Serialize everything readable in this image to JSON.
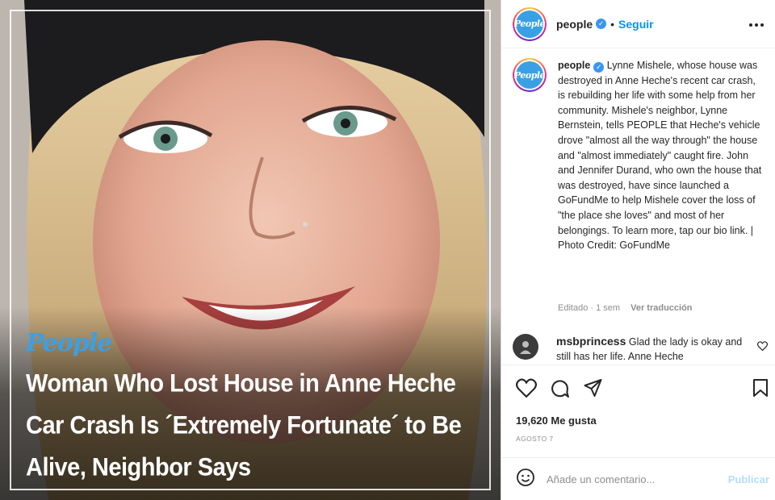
{
  "post": {
    "brand_logo": "People",
    "headline": "Woman Who Lost House in Anne Heche Car Crash Is ´Extremely Fortunate´ to Be Alive, Neighbor Says"
  },
  "header": {
    "avatar_text": "People",
    "username": "people",
    "separator": "•",
    "follow_label": "Seguir",
    "more_label": "•••"
  },
  "caption": {
    "username": "people",
    "text": "Lynne Mishele, whose house was destroyed in Anne Heche's recent car crash, is rebuilding her life with some help from her community. Mishele's neighbor, Lynne Bernstein, tells PEOPLE that Heche's vehicle drove \"almost all the way through\" the house and \"almost immediately\" caught fire. John and Jennifer Durand, who own the house that was destroyed, have since launched a GoFundMe to help Mishele cover the loss of \"the place she loves\" and most of her belongings. To learn more, tap our bio link. | Photo Credit: GoFundMe",
    "meta": "Editado · 1 sem",
    "translate_label": "Ver traducción"
  },
  "comment": {
    "username": "msbprincess",
    "text": "Glad the lady is okay and still has her life. Anne Heche"
  },
  "actions": {
    "likes": "19,620 Me gusta",
    "date": "AGOSTO 7"
  },
  "comment_box": {
    "placeholder": "Añade un comentario...",
    "publish_label": "Publicar"
  },
  "icons": {
    "like": "heart-icon",
    "comment": "comment-bubble-icon",
    "share": "paper-plane-icon",
    "save": "bookmark-icon",
    "emoji": "emoji-smile-icon",
    "verified": "verified-badge-icon",
    "more": "more-options-icon"
  },
  "colors": {
    "accent_link": "#0095f6",
    "brand_blue": "#3aa0e6",
    "publish_disabled": "#b2dffc",
    "muted_text": "#8e8e8e"
  }
}
